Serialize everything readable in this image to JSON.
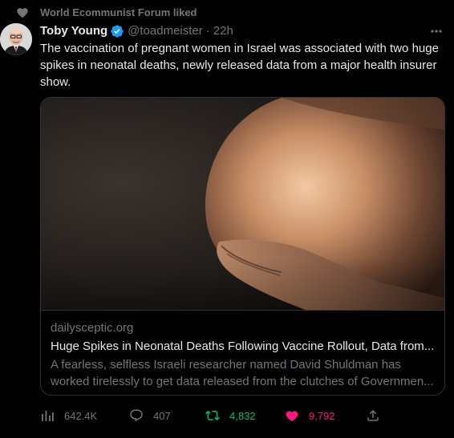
{
  "context": {
    "icon": "heart-icon",
    "text": "World Ecommunist Forum liked"
  },
  "tweet": {
    "author_name": "Toby Young",
    "verified": true,
    "handle": "@toadmeister",
    "separator": "·",
    "timestamp": "22h",
    "text": "The vaccination of pregnant women in Israel was associated with two huge spikes in neonatal deaths, newly released data from a major health insurer show."
  },
  "card": {
    "image": "pregnant-belly-photo",
    "domain": "dailysceptic.org",
    "title": "Huge Spikes in Neonatal Deaths Following Vaccine Rollout, Data from...",
    "description": "A fearless, selfless Israeli researcher named David Shuldman has worked tirelessly to get data released from the clutches of Governmen..."
  },
  "actions": {
    "views": "642.4K",
    "replies": "407",
    "retweets": "4,832",
    "likes": "9,792"
  },
  "colors": {
    "background": "#000000",
    "text": "#e7e9ea",
    "muted": "#71767b",
    "verified": "#1d9bf0",
    "retweet": "#00ba7c",
    "like": "#f91880",
    "border": "#2f3336"
  }
}
